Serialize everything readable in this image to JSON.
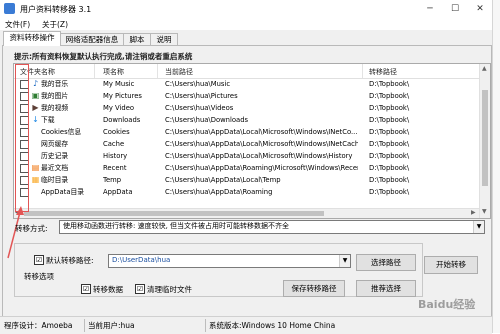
{
  "window": {
    "title": "用户资料转移器 3.1",
    "min": "─",
    "max": "☐",
    "close": "✕"
  },
  "menu": [
    "文件(F)",
    "关于(Z)"
  ],
  "tabs": [
    "资料转移操作",
    "网络适配器信息",
    "脚本",
    "说明"
  ],
  "hint": "提示:所有资料恢复默认执行完成,请注销或者重启系统",
  "table": {
    "headers": [
      "文件夹名称",
      "项名称",
      "当前路径",
      "转移路径"
    ],
    "rows": [
      {
        "icon": "music-note-icon",
        "glyph": "♪",
        "color": "#1565c0",
        "name": "我的音乐",
        "key": "My Music",
        "path": "C:\\Users\\hua\\Music",
        "target": "D:\\Topbook\\"
      },
      {
        "icon": "pictures-icon",
        "glyph": "▣",
        "color": "#2e7d32",
        "name": "我的图片",
        "key": "My Pictures",
        "path": "C:\\Users\\hua\\Pictures",
        "target": "D:\\Topbook\\"
      },
      {
        "icon": "video-icon",
        "glyph": "▶",
        "color": "#5d4037",
        "name": "我的视频",
        "key": "My Video",
        "path": "C:\\Users\\hua\\Videos",
        "target": "D:\\Topbook\\"
      },
      {
        "icon": "download-arrow-icon",
        "glyph": "↓",
        "color": "#1e88e5",
        "name": "下载",
        "key": "Downloads",
        "path": "C:\\Users\\hua\\Downloads",
        "target": "D:\\Topbook\\"
      },
      {
        "icon": "",
        "glyph": "",
        "color": "#000000",
        "name": "Cookies信息",
        "key": "Cookies",
        "path": "C:\\Users\\hua\\AppData\\Local\\Microsoft\\Windows\\INetCo...",
        "target": "D:\\Topbook\\"
      },
      {
        "icon": "",
        "glyph": "",
        "color": "#000000",
        "name": "网页缓存",
        "key": "Cache",
        "path": "C:\\Users\\hua\\AppData\\Local\\Microsoft\\Windows\\INetCache",
        "target": "D:\\Topbook\\"
      },
      {
        "icon": "",
        "glyph": "",
        "color": "#000000",
        "name": "历史记录",
        "key": "History",
        "path": "C:\\Users\\hua\\AppData\\Local\\Microsoft\\Windows\\History",
        "target": "D:\\Topbook\\"
      },
      {
        "icon": "recent-docs-icon",
        "glyph": "▤",
        "color": "#ef6c00",
        "name": "最近文档",
        "key": "Recent",
        "path": "C:\\Users\\hua\\AppData\\Roaming\\Microsoft\\Windows\\Recent",
        "target": "D:\\Topbook\\"
      },
      {
        "icon": "temp-folder-icon",
        "glyph": "▦",
        "color": "#f9a825",
        "name": "临时目录",
        "key": "Temp",
        "path": "C:\\Users\\hua\\AppData\\Local\\Temp",
        "target": "D:\\Topbook\\"
      },
      {
        "icon": "",
        "glyph": "",
        "color": "#000000",
        "name": "AppData目录",
        "key": "AppData",
        "path": "C:\\Users\\hua\\AppData\\Roaming",
        "target": "D:\\Topbook\\"
      }
    ]
  },
  "transfer_mode": {
    "label": "转移方式:",
    "value": "使用移动函数进行转移: 速度较快, 但当文件被占用时可能转移数据不齐全"
  },
  "options": {
    "group_title": "转移选项",
    "default_path_label": "默认转移路径:",
    "default_path_checked": "☑",
    "path_value": "D:\\UserData\\hua",
    "browse_button": "选择路径",
    "start_button": "开始转移",
    "transfer_data_label": "转移数据",
    "transfer_data_checked": "☑",
    "clean_temp_label": "清理临时文件",
    "clean_temp_checked": "☑",
    "save_path_button": "保存转移路径",
    "recommend_button": "推荐选择"
  },
  "status": {
    "designer": "程序设计：Amoeba",
    "user": "当前用户:hua",
    "system": "系统版本:Windows 10 Home China"
  },
  "watermark": "Baidu经验",
  "colors": {
    "annotation_red": "#e25555",
    "selection_blue": "#3a7bd5"
  }
}
